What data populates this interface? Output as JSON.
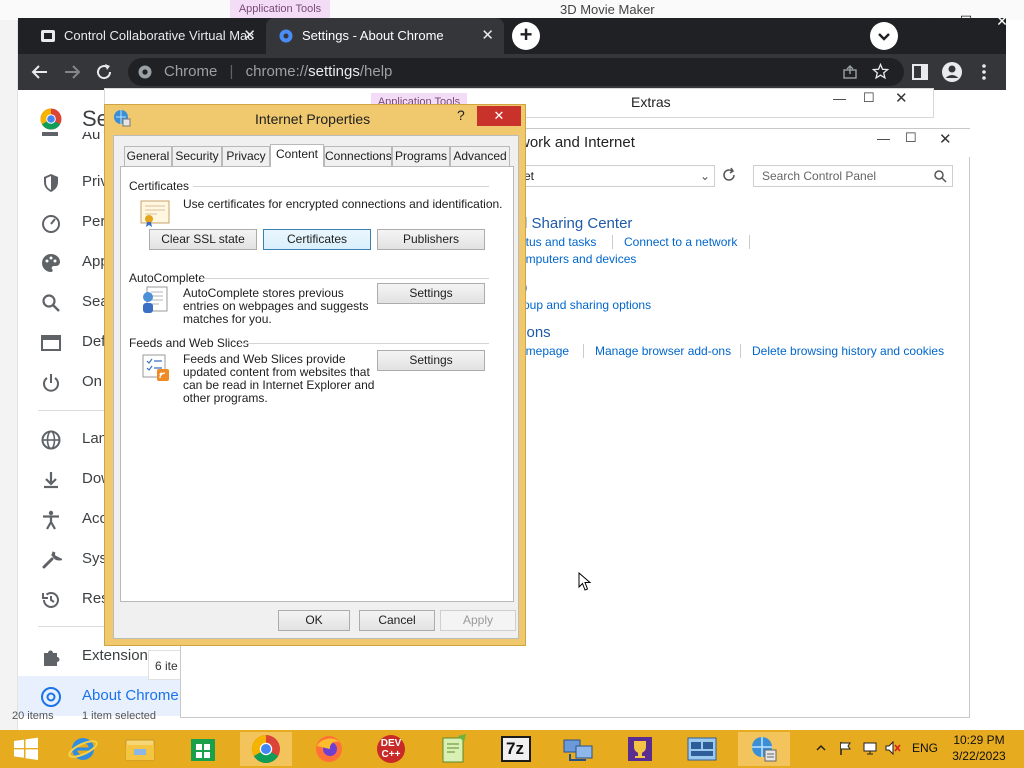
{
  "desktop": {
    "app_tools_label": "Application Tools",
    "window_title": "3D Movie Maker"
  },
  "chrome": {
    "tabs": [
      {
        "label": "Control Collaborative Virtual Mac",
        "icon": "vm-icon"
      },
      {
        "label": "Settings - About Chrome",
        "icon": "settings-gear-icon"
      }
    ],
    "omnibox": {
      "site": "Chrome",
      "url_host": "chrome://",
      "url_path_bold": "settings",
      "url_rest": "/help"
    }
  },
  "settings": {
    "header_partial": "Se",
    "nav": [
      {
        "label": "Au",
        "icon": "autofill-icon"
      },
      {
        "label": "Privacy and security",
        "icon": "shield-icon"
      },
      {
        "label": "Performance",
        "icon": "speedometer-icon"
      },
      {
        "label": "Appearance",
        "icon": "palette-icon"
      },
      {
        "label": "Search engine",
        "icon": "search-icon"
      },
      {
        "label": "Default browser",
        "icon": "browser-icon"
      },
      {
        "label": "On startup",
        "icon": "power-icon"
      },
      {
        "label": "Languages",
        "icon": "globe-icon"
      },
      {
        "label": "Downloads",
        "icon": "download-icon"
      },
      {
        "label": "Accessibility",
        "icon": "accessibility-icon"
      },
      {
        "label": "System",
        "icon": "wrench-icon"
      },
      {
        "label": "Reset settings",
        "icon": "history-icon"
      },
      {
        "label": "Extensions",
        "icon": "puzzle-icon"
      },
      {
        "label": "About Chrome",
        "icon": "chrome-logo-icon"
      }
    ]
  },
  "explorer_back": {
    "apptools": "Application Tools",
    "title": "Extras",
    "status_items": "20 items",
    "status_selected": "1 item selected",
    "count": "6 ite"
  },
  "control_panel": {
    "title": "Network and Internet",
    "title_visible": "work and Internet",
    "address": "et",
    "search_placeholder": "Search Control Panel",
    "section1_title": "d Sharing Center",
    "section1_links": [
      "atus and tasks",
      "Connect to a network",
      "omputers and devices"
    ],
    "section2_title": "p",
    "section2_links": [
      "roup and sharing options"
    ],
    "section3_title": "tions",
    "section3_links": [
      "omepage",
      "Manage browser add-ons",
      "Delete browsing history and cookies"
    ]
  },
  "internet_properties": {
    "title": "Internet Properties",
    "help": "?",
    "tabs": [
      "General",
      "Security",
      "Privacy",
      "Content",
      "Connections",
      "Programs",
      "Advanced"
    ],
    "active_tab": "Content",
    "certificates": {
      "group": "Certificates",
      "text": "Use certificates for encrypted connections and identification.",
      "buttons": [
        "Clear SSL state",
        "Certificates",
        "Publishers"
      ]
    },
    "autocomplete": {
      "group": "AutoComplete",
      "text": "AutoComplete stores previous entries on webpages and suggests matches for you.",
      "button": "Settings"
    },
    "feeds": {
      "group": "Feeds and Web Slices",
      "text": "Feeds and Web Slices provide updated content from websites that can be read in Internet Explorer and other programs.",
      "button": "Settings"
    },
    "footer": {
      "ok": "OK",
      "cancel": "Cancel",
      "apply": "Apply"
    }
  },
  "taskbar": {
    "apps": [
      "start-button",
      "internet-explorer-icon",
      "file-explorer-icon",
      "store-icon",
      "chrome-icon",
      "firefox-icon",
      "dev-cpp-icon",
      "notepad-plus-icon",
      "seven-zip-icon",
      "network-setup-icon",
      "trophy-icon",
      "control-panel-icon",
      "internet-options-icon"
    ],
    "devcpp_label": "DEV C++",
    "sevenzip_label": "7z",
    "lang": "ENG",
    "time": "10:29 PM",
    "date": "3/22/2023"
  },
  "colors": {
    "chrome_dark": "#202124",
    "chrome_tab_active": "#35363a",
    "dialog_frame": "#f0c96e",
    "taskbar": "#e6ab1f",
    "link_blue": "#0066cc",
    "close_red": "#c9322b"
  }
}
